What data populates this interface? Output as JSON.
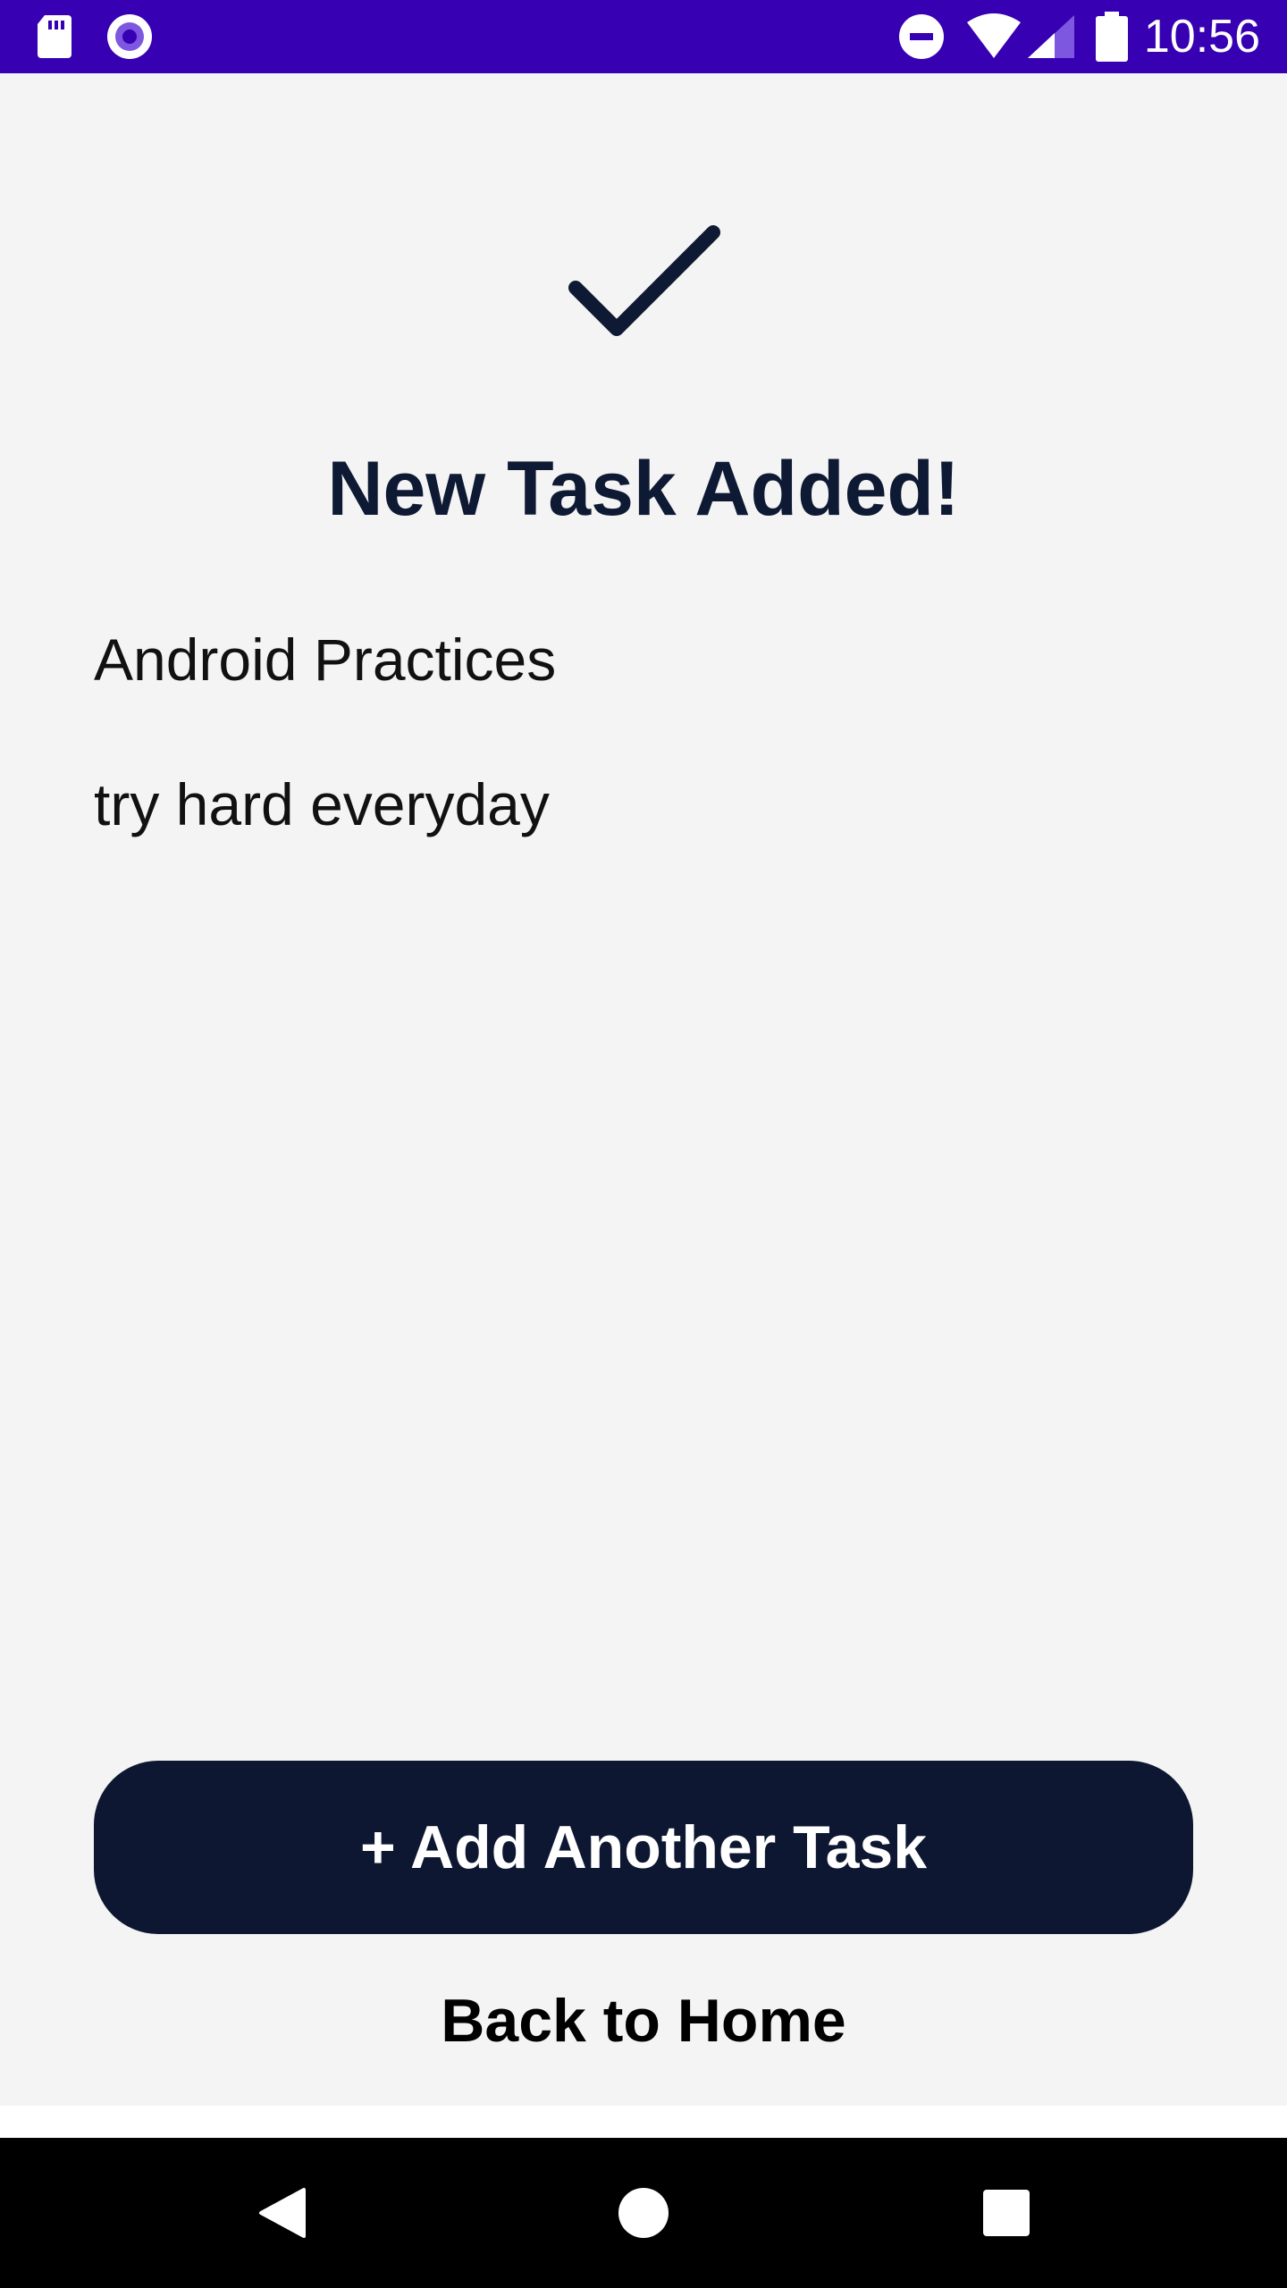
{
  "status_bar": {
    "time": "10:56",
    "icons": [
      "sd-card-icon",
      "record-icon",
      "do-not-disturb-icon",
      "wifi-icon",
      "cell-signal-icon",
      "battery-icon"
    ],
    "background": "#3700b3"
  },
  "main": {
    "title": "New Task Added!",
    "task_name": "Android Practices",
    "task_description": "try hard everyday",
    "icon": "checkmark-icon"
  },
  "actions": {
    "add_another_label": "+ Add Another Task",
    "back_home_label": "Back to Home"
  },
  "nav_bar": {
    "icons": [
      "back-icon",
      "home-icon",
      "recents-icon"
    ]
  },
  "colors": {
    "accent_dark": "#0d1731",
    "status_bar": "#3700b3",
    "background": "#f4f4f5"
  }
}
